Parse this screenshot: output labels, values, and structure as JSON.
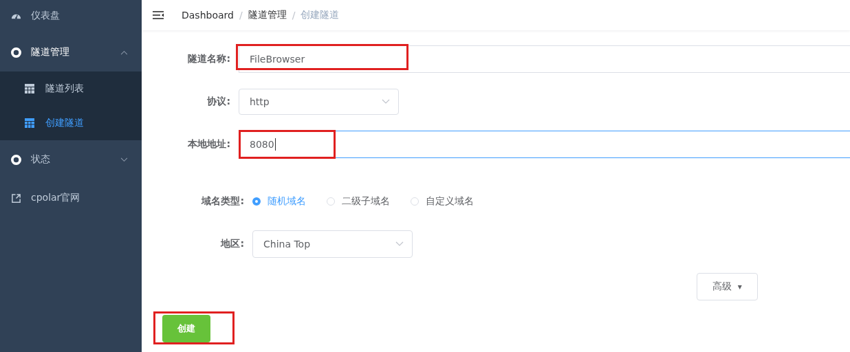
{
  "sidebar": {
    "items": [
      {
        "label": "仪表盘"
      },
      {
        "label": "隧道管理",
        "expanded": true,
        "children": [
          {
            "label": "隧道列表",
            "selected": false
          },
          {
            "label": "创建隧道",
            "selected": true
          }
        ]
      },
      {
        "label": "状态",
        "expanded": false
      },
      {
        "label": "cpolar官网"
      }
    ]
  },
  "breadcrumb": [
    {
      "label": "Dashboard"
    },
    {
      "separator": "/",
      "label": "隧道管理"
    },
    {
      "separator": "/",
      "label": "创建隧道"
    }
  ],
  "fields": [
    {
      "kind": "input",
      "label": "隧道名称:",
      "value": "FileBrowser",
      "focused": false,
      "highlighted": true
    },
    {
      "kind": "select",
      "label": "协议:",
      "value": "http",
      "focused": false,
      "highlighted": false
    },
    {
      "kind": "input",
      "label": "本地地址:",
      "value": "8080",
      "focused": true,
      "highlighted": true
    }
  ],
  "domain_type": {
    "label": "域名类型:",
    "options": [
      {
        "label": "随机域名",
        "selected": true
      },
      {
        "label": "二级子域名",
        "selected": false
      },
      {
        "label": "自定义域名",
        "selected": false
      }
    ]
  },
  "region": {
    "label": "地区:",
    "value": "China Top"
  },
  "advanced_button": {
    "label": "高级",
    "caret": "▾"
  },
  "create_button": {
    "label": "创建",
    "highlighted": true
  }
}
